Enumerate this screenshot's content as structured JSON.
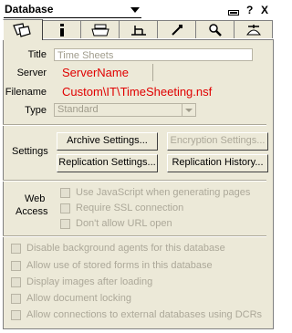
{
  "header": {
    "database_select": "Database",
    "icons": [
      "tiny-window-icon",
      "help-icon",
      "close-icon"
    ],
    "help_label": "?",
    "close_label": "X"
  },
  "tabs": [
    {
      "name": "tab-basics",
      "icon": "info-bubbles-icon",
      "active": true
    },
    {
      "name": "tab-info",
      "icon": "info-icon",
      "active": false
    },
    {
      "name": "tab-print",
      "icon": "printer-icon",
      "active": false
    },
    {
      "name": "tab-design",
      "icon": "design-tool-icon",
      "active": false
    },
    {
      "name": "tab-launch",
      "icon": "rocket-icon",
      "active": false
    },
    {
      "name": "tab-search",
      "icon": "magnifier-icon",
      "active": false
    },
    {
      "name": "tab-advanced",
      "icon": "propeller-hat-icon",
      "active": false
    }
  ],
  "basics": {
    "title_label": "Title",
    "title_placeholder": "Time Sheets",
    "server_label": "Server",
    "server_value": "ServerName",
    "filename_label": "Filename",
    "filename_value": "Custom\\IT\\TimeSheeting.nsf",
    "type_label": "Type",
    "type_value": "Standard"
  },
  "settings": {
    "label": "Settings",
    "archive": "Archive Settings...",
    "encryption": "Encryption Settings...",
    "replication": "Replication Settings...",
    "history": "Replication History..."
  },
  "web_access": {
    "label_line1": "Web",
    "label_line2": "Access",
    "options": [
      "Use JavaScript when generating pages",
      "Require SSL connection",
      "Don't allow URL open"
    ]
  },
  "options": [
    "Disable background agents for this database",
    "Allow use of stored forms in this database",
    "Display images after loading",
    "Allow document locking",
    "Allow connections to external databases using DCRs"
  ]
}
